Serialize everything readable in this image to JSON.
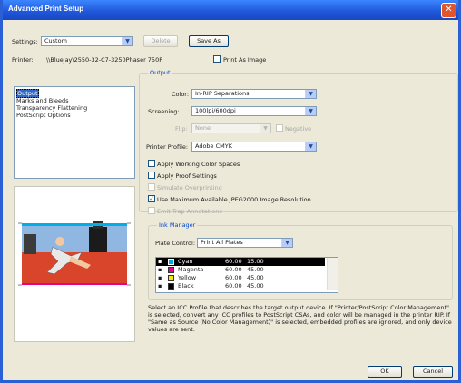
{
  "window": {
    "title": "Advanced Print Setup",
    "close_glyph": "✕"
  },
  "settings": {
    "label": "Settings:",
    "value": "Custom",
    "delete_label": "Delete",
    "save_as_label": "Save As"
  },
  "printer": {
    "label": "Printer:",
    "value": "\\\\Bluejay\\2550-32-C7-3250Phaser 750P",
    "print_as_image_label": "Print As Image"
  },
  "sidebar": {
    "items": [
      {
        "label": "Output"
      },
      {
        "label": "Marks and Bleeds"
      },
      {
        "label": "Transparency Flattening"
      },
      {
        "label": "PostScript Options"
      }
    ]
  },
  "output": {
    "group_title": "Output",
    "color_label": "Color:",
    "color_value": "In-RIP Separations",
    "screening_label": "Screening:",
    "screening_value": "100lpi/600dpi",
    "flip_label": "Flip:",
    "flip_value": "None",
    "negative_label": "Negative",
    "printer_profile_label": "Printer Profile:",
    "printer_profile_value": "Adobe CMYK",
    "options": [
      {
        "label": "Apply Working Color Spaces",
        "checked": false,
        "enabled": true
      },
      {
        "label": "Apply Proof Settings",
        "checked": false,
        "enabled": true
      },
      {
        "label": "Simulate Overprinting",
        "checked": false,
        "enabled": false
      },
      {
        "label": "Use Maximum Available JPEG2000 Image Resolution",
        "checked": true,
        "enabled": true
      },
      {
        "label": "Emit Trap Annotations",
        "checked": false,
        "enabled": false
      }
    ]
  },
  "ink_manager": {
    "group_title": "Ink Manager",
    "plate_control_label": "Plate Control:",
    "plate_control_value": "Print All Plates",
    "inks": [
      {
        "name": "Cyan",
        "frequency": "60.00",
        "angle": "15.00",
        "color": "#00a6e6"
      },
      {
        "name": "Magenta",
        "frequency": "60.00",
        "angle": "45.00",
        "color": "#e6008c"
      },
      {
        "name": "Yellow",
        "frequency": "60.00",
        "angle": "45.00",
        "color": "#ffe600"
      },
      {
        "name": "Black",
        "frequency": "60.00",
        "angle": "45.00",
        "color": "#000000"
      }
    ]
  },
  "description": "Select an ICC Profile that describes the target output device. If \"Printer/PostScript Color Management\" is selected, convert any ICC profiles to PostScript CSAs, and color will be managed in the printer RIP. If \"Same as Source (No Color Management)\" is selected, embedded profiles are ignored, and only device values are sent.",
  "footer": {
    "ok_label": "OK",
    "cancel_label": "Cancel"
  }
}
